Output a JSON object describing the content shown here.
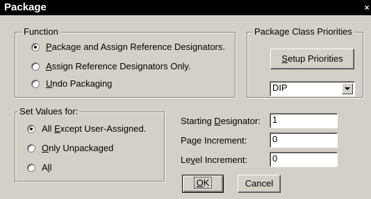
{
  "window": {
    "title": "Package",
    "close_glyph": "×"
  },
  "function_group": {
    "legend": "Function",
    "options": [
      {
        "pre": "",
        "mnemonic": "P",
        "post": "ackage and Assign Reference Designators.",
        "checked": true
      },
      {
        "pre": "",
        "mnemonic": "A",
        "post": "ssign Reference Designators Only.",
        "checked": false
      },
      {
        "pre": "",
        "mnemonic": "U",
        "post": "ndo Packaging",
        "checked": false
      }
    ]
  },
  "priorities_group": {
    "legend": "Package Class Priorities",
    "setup_button": {
      "pre": "",
      "mnemonic": "S",
      "post": "etup Priorities"
    },
    "class_select": {
      "value": "DIP",
      "icon": "chevron-down-icon"
    }
  },
  "set_values_group": {
    "legend": "Set Values for:",
    "options": [
      {
        "pre": "All ",
        "mnemonic": "E",
        "post": "xcept User-Assigned.",
        "checked": true
      },
      {
        "pre": "",
        "mnemonic": "O",
        "post": "nly Unpackaged",
        "checked": false
      },
      {
        "pre": "A",
        "mnemonic": "l",
        "post": "l",
        "checked": false
      }
    ]
  },
  "fields": {
    "starting_designator": {
      "label_pre": "Starting ",
      "label_mnemonic": "D",
      "label_post": "esignator:",
      "value": "1"
    },
    "page_increment": {
      "label": "Page Increment:",
      "value": "0"
    },
    "level_increment": {
      "label_pre": "Le",
      "label_mnemonic": "v",
      "label_post": "el Increment:",
      "value": "0"
    }
  },
  "buttons": {
    "ok": {
      "pre": "",
      "mnemonic": "O",
      "post": "K"
    },
    "cancel": "Cancel"
  }
}
